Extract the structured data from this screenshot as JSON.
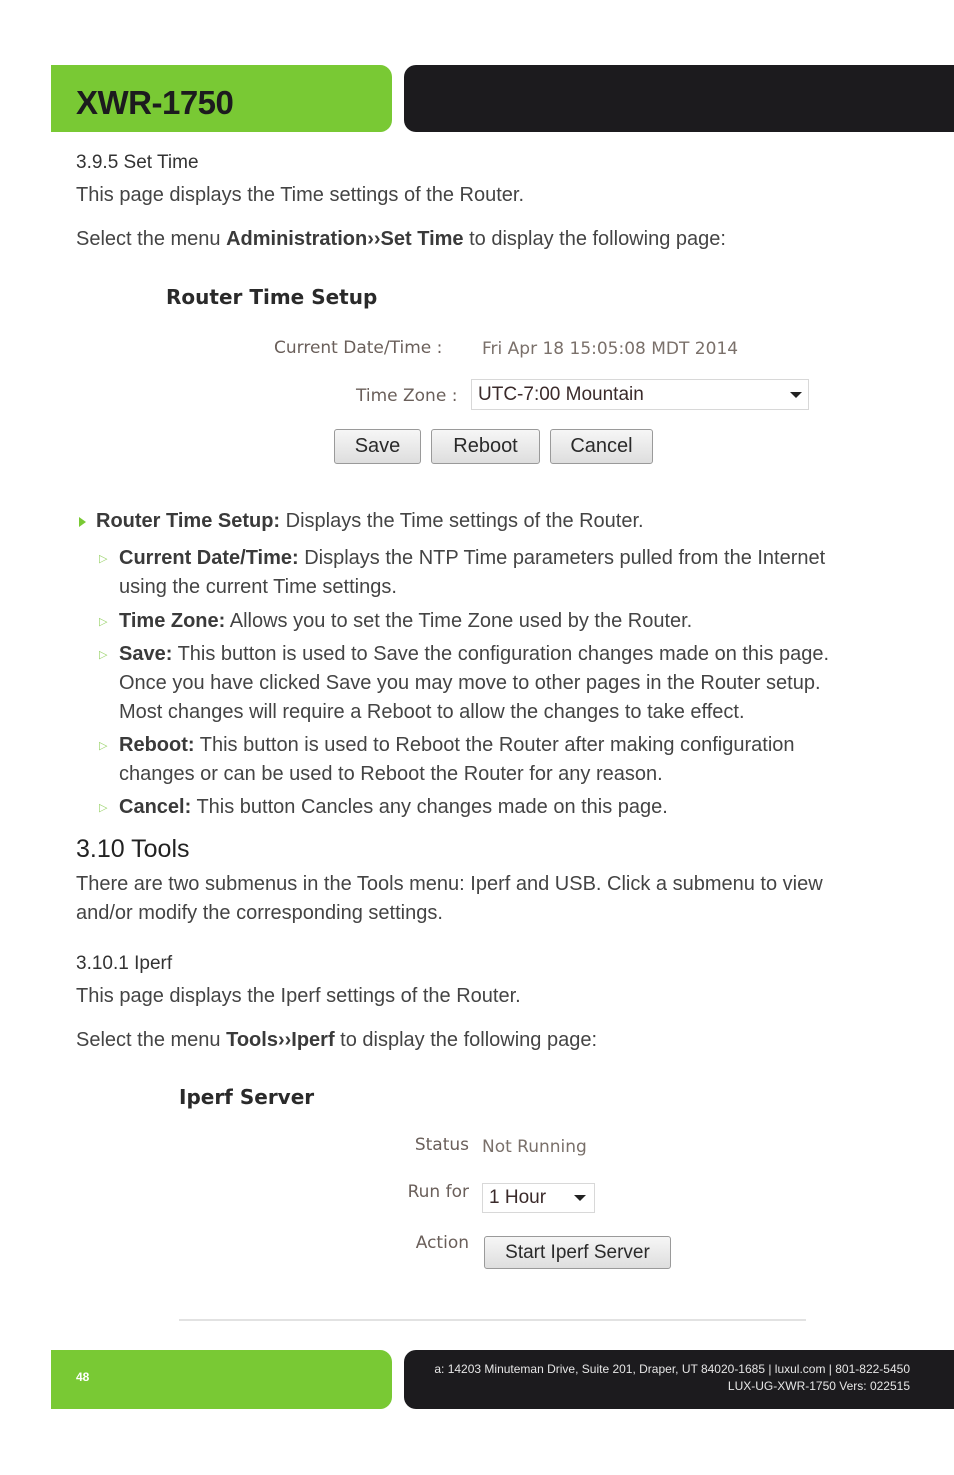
{
  "header": {
    "title": "XWR-1750"
  },
  "set_time": {
    "heading": "3.9.5 Set Time",
    "intro": "This page displays the Time settings of the Router.",
    "menu_prefix": "Select the menu ",
    "menu_path": "Administration››Set Time",
    "menu_suffix": " to display the following page:"
  },
  "router_time_ui": {
    "title": "Router Time Setup",
    "current_label": "Current Date/Time :",
    "current_value": "Fri Apr 18 15:05:08 MDT 2014",
    "timezone_label": "Time Zone :",
    "timezone_value": "UTC-7:00 Mountain",
    "buttons": {
      "save": "Save",
      "reboot": "Reboot",
      "cancel": "Cancel"
    }
  },
  "bullets": {
    "main": {
      "term": "Router Time Setup:",
      "text": " Displays the Time settings of the Router."
    },
    "items": [
      {
        "term": "Current Date/Time:",
        "lines": [
          " Displays the NTP Time parameters pulled from the Internet",
          "using the current Time settings."
        ]
      },
      {
        "term": "Time Zone:",
        "lines": [
          " Allows you to set the Time Zone used by the Router."
        ]
      },
      {
        "term": "Save:",
        "lines": [
          " This button is used to Save the configuration changes made on this page.",
          "Once you have clicked Save you may move to other pages in the Router setup.",
          "Most changes will require a Reboot to allow the changes to take effect."
        ]
      },
      {
        "term": "Reboot:",
        "lines": [
          " This button is used to Reboot the Router after making configuration",
          "changes or can be used to Reboot the Router for any reason."
        ]
      },
      {
        "term": "Cancel:",
        "lines": [
          " This button Cancles any changes made on this page."
        ]
      }
    ]
  },
  "tools": {
    "heading": "3.10 Tools",
    "intro_lines": [
      "There are two submenus in the Tools menu: Iperf and USB. Click a submenu to view",
      "and/or modify the corresponding settings."
    ]
  },
  "iperf": {
    "heading": "3.10.1 Iperf",
    "intro": "This page displays the Iperf settings of the Router.",
    "menu_prefix": "Select the menu ",
    "menu_path": "Tools››Iperf",
    "menu_suffix": " to display the following page:"
  },
  "iperf_ui": {
    "title": "Iperf Server",
    "status_label": "Status",
    "status_value": "Not Running",
    "runfor_label": "Run for",
    "runfor_value": "1 Hour",
    "action_label": "Action",
    "start_button": "Start Iperf Server"
  },
  "footer": {
    "page_number": "48",
    "address": "a: 14203 Minuteman Drive, Suite 201, Draper, UT 84020-1685 | luxul.com | 801-822-5450",
    "doc_version": "LUX-UG-XWR-1750  Vers: 022515"
  },
  "colors": {
    "brand_green": "#79c934",
    "brand_black": "#1c1b1e"
  }
}
